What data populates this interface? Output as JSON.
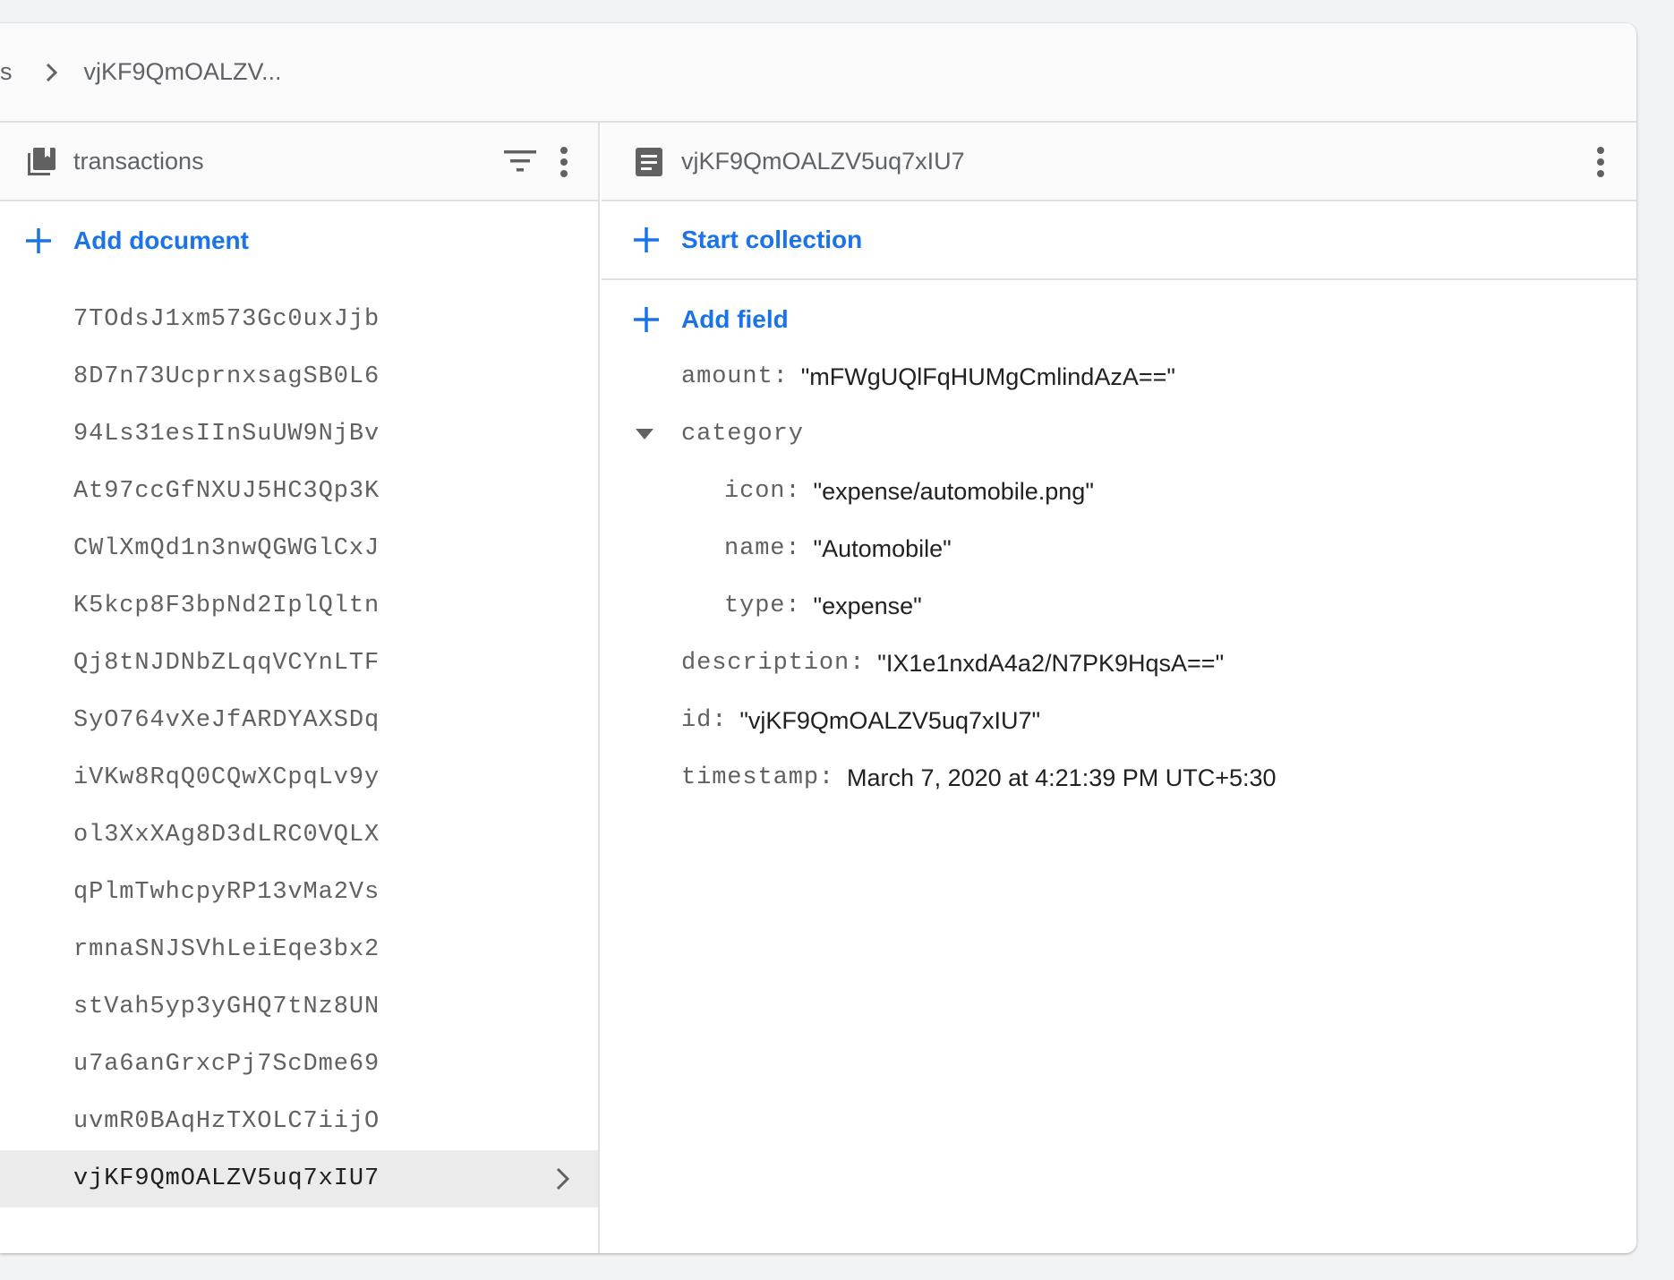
{
  "breadcrumb": {
    "prev": "s",
    "current": "vjKF9QmOALZV..."
  },
  "collection": {
    "title": "transactions",
    "add_document": "Add document",
    "documents": [
      "7TOdsJ1xm573Gc0uxJjb",
      "8D7n73UcprnxsagSB0L6",
      "94Ls31esIInSuUW9NjBv",
      "At97ccGfNXUJ5HC3Qp3K",
      "CWlXmQd1n3nwQGWGlCxJ",
      "K5kcp8F3bpNd2IplQltn",
      "Qj8tNJDNbZLqqVCYnLTF",
      "SyO764vXeJfARDYAXSDq",
      "iVKw8RqQ0CQwXCpqLv9y",
      "ol3XxXAg8D3dLRC0VQLX",
      "qPlmTwhcpyRP13vMa2Vs",
      "rmnaSNJSVhLeiEqe3bx2",
      "stVah5yp3yGHQ7tNz8UN",
      "u7a6anGrxcPj7ScDme69",
      "uvmR0BAqHzTXOLC7iijO",
      "vjKF9QmOALZV5uq7xIU7"
    ],
    "selected": "vjKF9QmOALZV5uq7xIU7"
  },
  "document": {
    "title": "vjKF9QmOALZV5uq7xIU7",
    "start_collection": "Start collection",
    "add_field": "Add field",
    "fields": {
      "amount": {
        "key": "amount:",
        "value": "\"mFWgUQlFqHUMgCmlindAzA==\""
      },
      "category": {
        "key": "category",
        "icon": {
          "key": "icon:",
          "value": "\"expense/automobile.png\""
        },
        "name": {
          "key": "name:",
          "value": "\"Automobile\""
        },
        "type": {
          "key": "type:",
          "value": "\"expense\""
        }
      },
      "description": {
        "key": "description:",
        "value": "\"IX1e1nxdA4a2/N7PK9HqsA==\""
      },
      "id": {
        "key": "id:",
        "value": "\"vjKF9QmOALZV5uq7xIU7\""
      },
      "timestamp": {
        "key": "timestamp:",
        "value": "March 7, 2020 at 4:21:39 PM UTC+5:30"
      }
    }
  },
  "colors": {
    "accent": "#1a73e8",
    "selected_row": "#ebebeb"
  }
}
